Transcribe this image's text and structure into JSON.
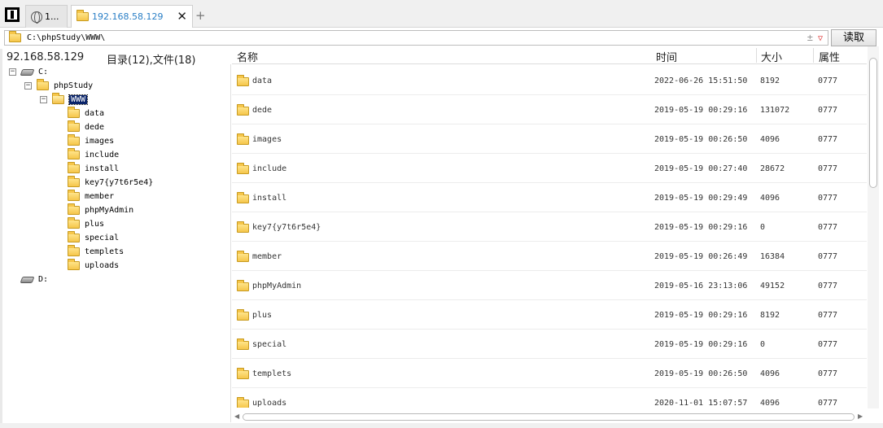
{
  "tabs": [
    {
      "label": "1...",
      "icon": "globe-icon"
    },
    {
      "label": "192.168.58.129",
      "icon": "folder-icon",
      "active": true
    }
  ],
  "tab_bar": {
    "close": "✕",
    "add": "+"
  },
  "path_bar": {
    "value": "C:\\phpStudy\\WWW\\",
    "tools": "±",
    "dropdown": "▽",
    "read_button": "读取"
  },
  "status": {
    "ip": "92.168.58.129",
    "counts": "目录(12),文件(18)"
  },
  "tree": {
    "drive_c": "C:",
    "phpstudy": "phpStudy",
    "www": "WWW",
    "children": [
      "data",
      "dede",
      "images",
      "include",
      "install",
      "key7{y7t6r5e4}",
      "member",
      "phpMyAdmin",
      "plus",
      "special",
      "templets",
      "uploads"
    ],
    "drive_d": "D:"
  },
  "list": {
    "columns": {
      "name": "名称",
      "time": "时间",
      "size": "大小",
      "attr": "属性"
    },
    "rows": [
      {
        "name": "data",
        "time": "2022-06-26 15:51:50",
        "size": "8192",
        "attr": "0777"
      },
      {
        "name": "dede",
        "time": "2019-05-19 00:29:16",
        "size": "131072",
        "attr": "0777"
      },
      {
        "name": "images",
        "time": "2019-05-19 00:26:50",
        "size": "4096",
        "attr": "0777"
      },
      {
        "name": "include",
        "time": "2019-05-19 00:27:40",
        "size": "28672",
        "attr": "0777"
      },
      {
        "name": "install",
        "time": "2019-05-19 00:29:49",
        "size": "4096",
        "attr": "0777"
      },
      {
        "name": "key7{y7t6r5e4}",
        "time": "2019-05-19 00:29:16",
        "size": "0",
        "attr": "0777"
      },
      {
        "name": "member",
        "time": "2019-05-19 00:26:49",
        "size": "16384",
        "attr": "0777"
      },
      {
        "name": "phpMyAdmin",
        "time": "2019-05-16 23:13:06",
        "size": "49152",
        "attr": "0777"
      },
      {
        "name": "plus",
        "time": "2019-05-19 00:29:16",
        "size": "8192",
        "attr": "0777"
      },
      {
        "name": "special",
        "time": "2019-05-19 00:29:16",
        "size": "0",
        "attr": "0777"
      },
      {
        "name": "templets",
        "time": "2019-05-19 00:26:50",
        "size": "4096",
        "attr": "0777"
      },
      {
        "name": "uploads",
        "time": "2020-11-01 15:07:57",
        "size": "4096",
        "attr": "0777"
      }
    ]
  }
}
